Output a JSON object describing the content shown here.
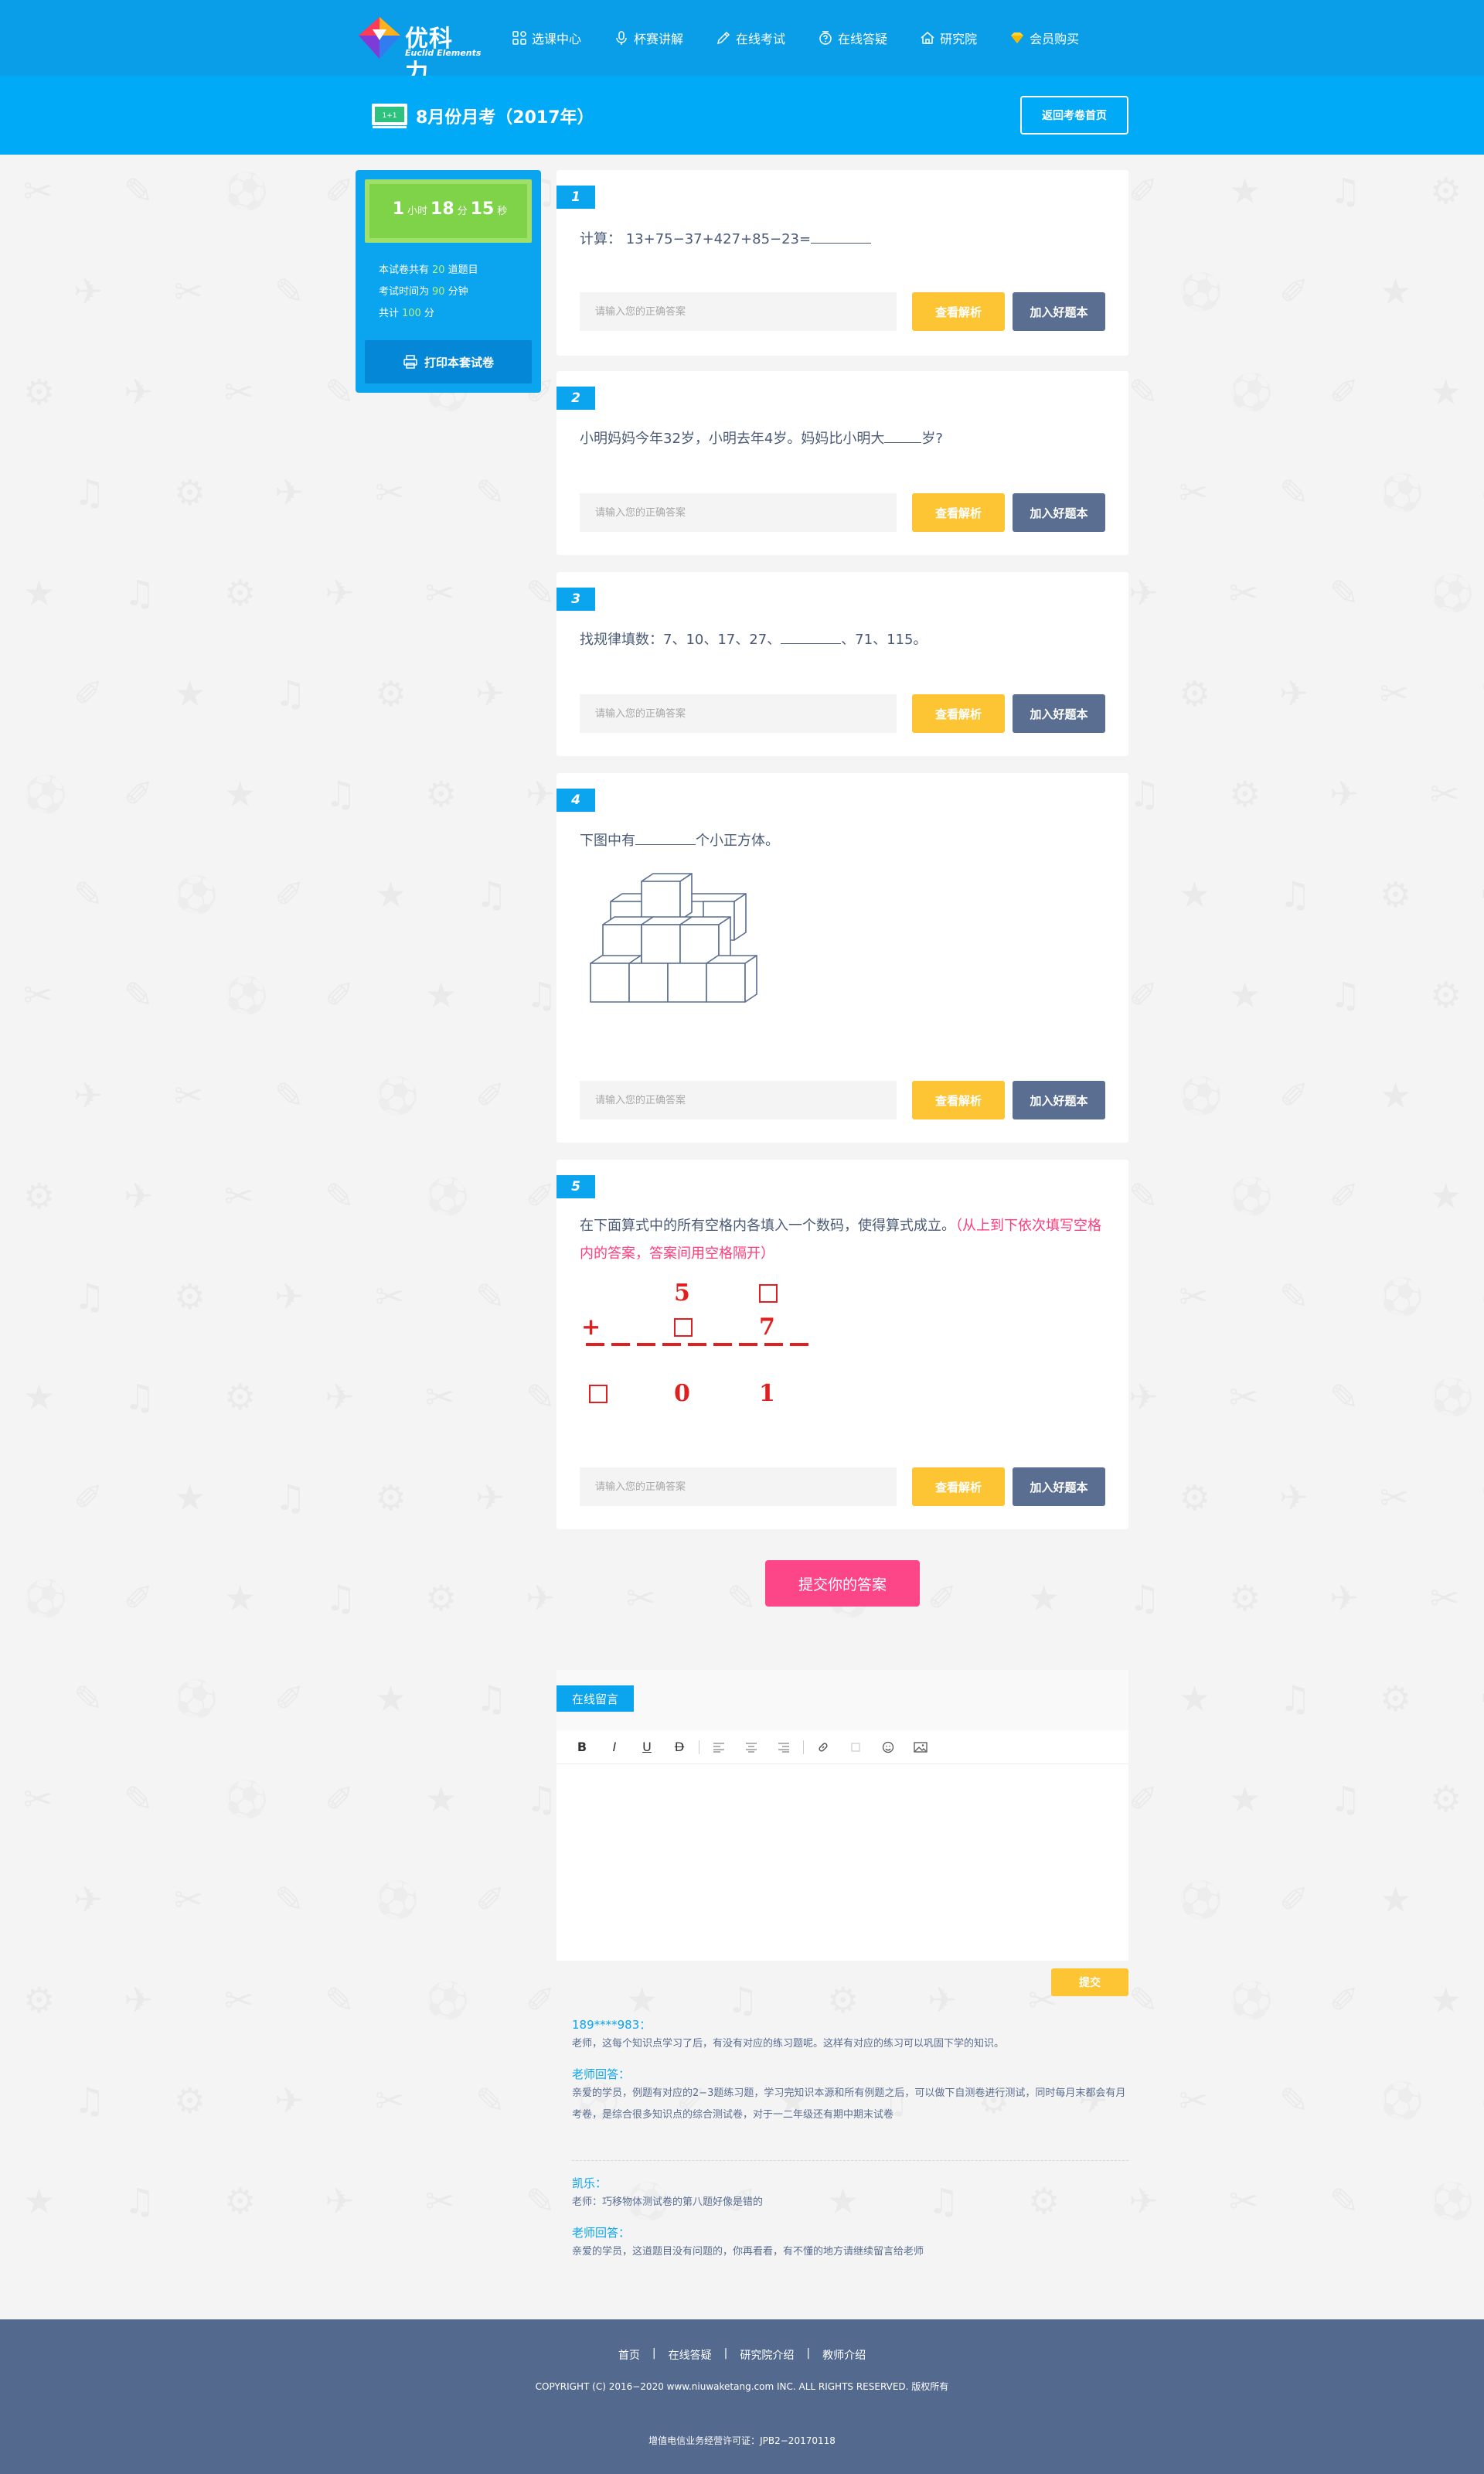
{
  "header": {
    "logo_text": "优科力",
    "logo_sub": "Euclid Elements",
    "nav": [
      {
        "label": "选课中心",
        "icon": "grid-icon"
      },
      {
        "label": "杯赛讲解",
        "icon": "microphone-icon"
      },
      {
        "label": "在线考试",
        "icon": "pencil-icon"
      },
      {
        "label": "在线答疑",
        "icon": "question-icon"
      },
      {
        "label": "研究院",
        "icon": "home-icon"
      },
      {
        "label": "会员购买",
        "icon": "diamond-icon"
      }
    ]
  },
  "subheader": {
    "title": "8月份月考（2017年）",
    "back_label": "返回考卷首页",
    "icon_text": "1+1"
  },
  "sidebar": {
    "timer": {
      "hours": "1",
      "hours_unit": "小时",
      "minutes": "18",
      "minutes_unit": "分",
      "seconds": "15",
      "seconds_unit": "秒"
    },
    "info": [
      {
        "prefix": "本试卷共有",
        "value": "20",
        "suffix": "道题目"
      },
      {
        "prefix": "考试时间为",
        "value": "90",
        "suffix": "分钟"
      },
      {
        "prefix": "共计",
        "value": "100",
        "suffix": "分"
      }
    ],
    "print_label": "打印本套试卷"
  },
  "answer_placeholder": "请输入您的正确答案",
  "analysis_label": "查看解析",
  "add_label": "加入好题本",
  "questions": [
    {
      "number": "1",
      "text_a": "计算：  13+75−37+427+85−23="
    },
    {
      "number": "2",
      "text_a": "小明妈妈今年32岁，小明去年4岁。妈妈比小明大",
      "text_b": "岁?"
    },
    {
      "number": "3",
      "text_a": "找规律填数：7、10、17、27、",
      "text_b": "、71、115。"
    },
    {
      "number": "4",
      "text_a": "下图中有",
      "text_b": "个小正方体。"
    },
    {
      "number": "5",
      "text_a": "在下面算式中的所有空格内各填入一个数码，使得算式成立。",
      "hint": "（从上到下依次填写空格内的答案，答案间用空格隔开）",
      "figure": {
        "row1": [
          "5",
          "□"
        ],
        "row2_op": "+",
        "row2": [
          "□",
          "7"
        ],
        "row3": [
          "□",
          "0",
          "1"
        ]
      }
    }
  ],
  "submit_label": "提交你的答案",
  "message": {
    "tab_label": "在线留言",
    "toolbar": [
      "B",
      "I",
      "U",
      "D"
    ],
    "submit_label": "提交"
  },
  "comments": [
    {
      "user": "189****983：",
      "text": "老师，这每个知识点学习了后，有没有对应的练习题呢。这样有对应的练习可以巩固下学的知识。",
      "reply_label": "老师回答：",
      "reply": "亲爱的学员，例题有对应的2−3题练习题，学习完知识本源和所有例题之后，可以做下自测卷进行测试，同时每月末都会有月考卷，是综合很多知识点的综合测试卷，对于一二年级还有期中期末试卷"
    },
    {
      "user": "凯乐：",
      "text": "老师：巧移物体测试卷的第八题好像是错的",
      "reply_label": "老师回答：",
      "reply": "亲爱的学员，这道题目没有问题的，你再看看，有不懂的地方请继续留言给老师"
    }
  ],
  "footer": {
    "links": [
      "首页",
      "在线答疑",
      "研究院介绍",
      "教师介绍"
    ],
    "copyright": "COPYRIGHT (C) 2016−2020 www.niuwaketang.com INC. ALL RIGHTS RESERVED. 版权所有",
    "license": "增值电信业务经营许可证：JPB2−20170118"
  },
  "colors": {
    "primary": "#0a9ee8",
    "accent_yellow": "#fdc534",
    "slate": "#5a6e91",
    "pink": "#fd4688",
    "green": "#7ed348"
  }
}
